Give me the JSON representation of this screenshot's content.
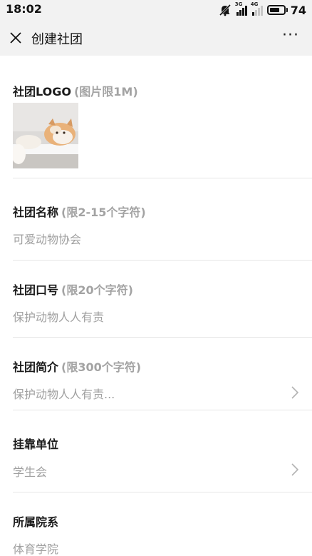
{
  "status_bar": {
    "time": "18:02",
    "net_3g": "3G",
    "net_4g": "4G",
    "battery_level": "74",
    "battery_fraction": 0.74
  },
  "nav": {
    "title": "创建社团",
    "close_icon": "close-icon",
    "more_label": "···"
  },
  "form": {
    "logo": {
      "label": "社团LOGO",
      "hint": "(图片限1M)"
    },
    "name": {
      "label": "社团名称",
      "hint": "(限2-15个字符)",
      "value": "可爱动物协会"
    },
    "slogan": {
      "label": "社团口号",
      "hint": "(限20个字符)",
      "value": "保护动物人人有责"
    },
    "intro": {
      "label": "社团简介",
      "hint": "(限300个字符)",
      "value": "保护动物人人有责..."
    },
    "affiliation": {
      "label": "挂靠单位",
      "value": "学生会"
    },
    "department": {
      "label": "所属院系",
      "value": "体育学院"
    }
  },
  "colors": {
    "bar_bg": "#f2f2f2",
    "hint": "#a3a3a3",
    "value": "#a0a0a0",
    "divider": "#e5e5e5"
  }
}
